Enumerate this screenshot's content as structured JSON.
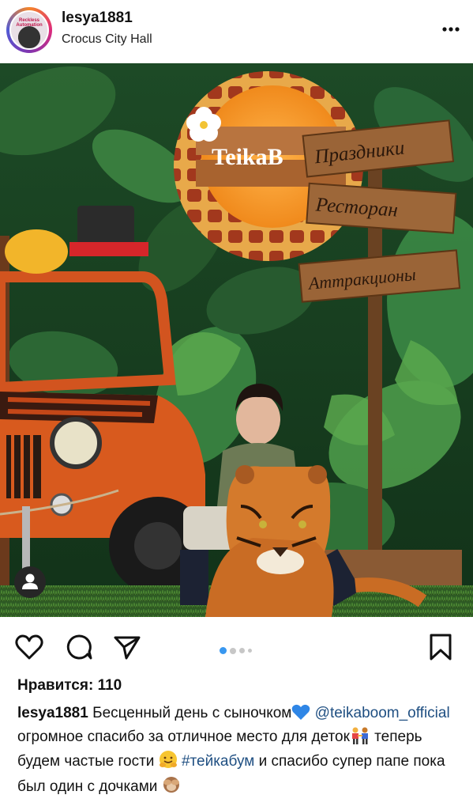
{
  "post": {
    "username": "lesya1881",
    "location": "Crocus City Hall",
    "avatar_text": "Reckless Automation",
    "likes_label": "Нравится: 110"
  },
  "photo": {
    "sign_logo": "TeikaB",
    "signs": [
      "Праздники",
      "Ресторан",
      "Аттракционы"
    ]
  },
  "carousel": {
    "count": 4,
    "active_index": 0
  },
  "caption": {
    "username": "lesya1881",
    "line1": " Бесценный день с сыночком",
    "mention": "@teikaboom_official",
    "line2": " огромное спасибо за отличное место для деток",
    "line3": " теперь будем частые гости ",
    "hashtag": "#тейкабум",
    "line4": " и спасибо супер папе пока был один с дочками "
  },
  "icons": {
    "more": "more-dots-icon",
    "like": "heart-icon",
    "comment": "comment-icon",
    "share": "send-icon",
    "save": "bookmark-icon",
    "tag": "user-tag-icon"
  },
  "colors": {
    "accent_blue": "#3897f0",
    "link": "#1f4f82"
  }
}
